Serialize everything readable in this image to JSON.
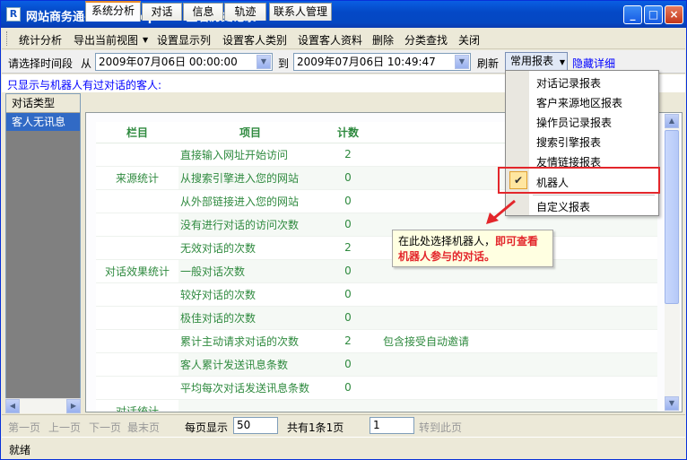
{
  "window": {
    "title": "网站商务通-LiveReception 查看历史记录",
    "app_icon": "R"
  },
  "menu": [
    "统计分析",
    "导出当前视图",
    "设置显示列",
    "设置客人类别",
    "设置客人资料",
    "删除",
    "分类查找",
    "关闭"
  ],
  "filter": {
    "period_label": "请选择时间段",
    "from_label": "从",
    "from_value": "2009年07月06日 00:00:00",
    "to_label": "到",
    "to_value": "2009年07月06日 10:49:47",
    "refresh": "刷新",
    "report_button": "常用报表",
    "hide_details": "隐藏详细"
  },
  "robot_only_link": "只显示与机器人有过对话的客人:",
  "left_panel": {
    "header": "对话类型",
    "selected": "客人无讯息"
  },
  "tabs": [
    "系统分析",
    "对话",
    "信息",
    "轨迹",
    "联系人管理"
  ],
  "grid": {
    "headers": {
      "category": "栏目",
      "item": "项目",
      "count": "计数"
    },
    "rows": [
      {
        "cat": "",
        "item": "直接输入网址开始访问",
        "count": "2",
        "note": ""
      },
      {
        "cat": "来源统计",
        "item": "从搜索引擎进入您的网站",
        "count": "0",
        "note": ""
      },
      {
        "cat": "",
        "item": "从外部链接进入您的网站",
        "count": "0",
        "note": ""
      },
      {
        "cat": "",
        "item": "没有进行对话的访问次数",
        "count": "0",
        "note": ""
      },
      {
        "cat": "",
        "item": "无效对话的次数",
        "count": "2",
        "note": ""
      },
      {
        "cat": "对话效果统计",
        "item": "一般对话次数",
        "count": "0",
        "note": ""
      },
      {
        "cat": "",
        "item": "较好对话的次数",
        "count": "0",
        "note": ""
      },
      {
        "cat": "",
        "item": "极佳对话的次数",
        "count": "0",
        "note": ""
      },
      {
        "cat": "",
        "item": "累计主动请求对话的次数",
        "count": "2",
        "note": "包含接受自动邀请"
      },
      {
        "cat": "",
        "item": "客人累计发送讯息条数",
        "count": "0",
        "note": ""
      },
      {
        "cat": "",
        "item": "平均每次对话发送讯息条数",
        "count": "0",
        "note": ""
      },
      {
        "cat": "对话统计",
        "item": "",
        "count": "",
        "note": ""
      }
    ]
  },
  "pager": {
    "first": "第一页",
    "prev": "上一页",
    "next": "下一页",
    "last": "最末页",
    "per_page_label": "每页显示",
    "per_page_value": "50",
    "total": "共有1条1页",
    "page_value": "1",
    "goto": "转到此页"
  },
  "status": "就绪",
  "report_menu": {
    "items": [
      "对话记录报表",
      "客户来源地区报表",
      "操作员记录报表",
      "搜索引擎报表",
      "友情链接报表",
      "机器人",
      "自定义报表"
    ],
    "checked_index": 5
  },
  "callout": {
    "normal": "在此处选择机器人，",
    "highlight1": "即可查看",
    "highlight2": "机器人参与的对话。"
  }
}
